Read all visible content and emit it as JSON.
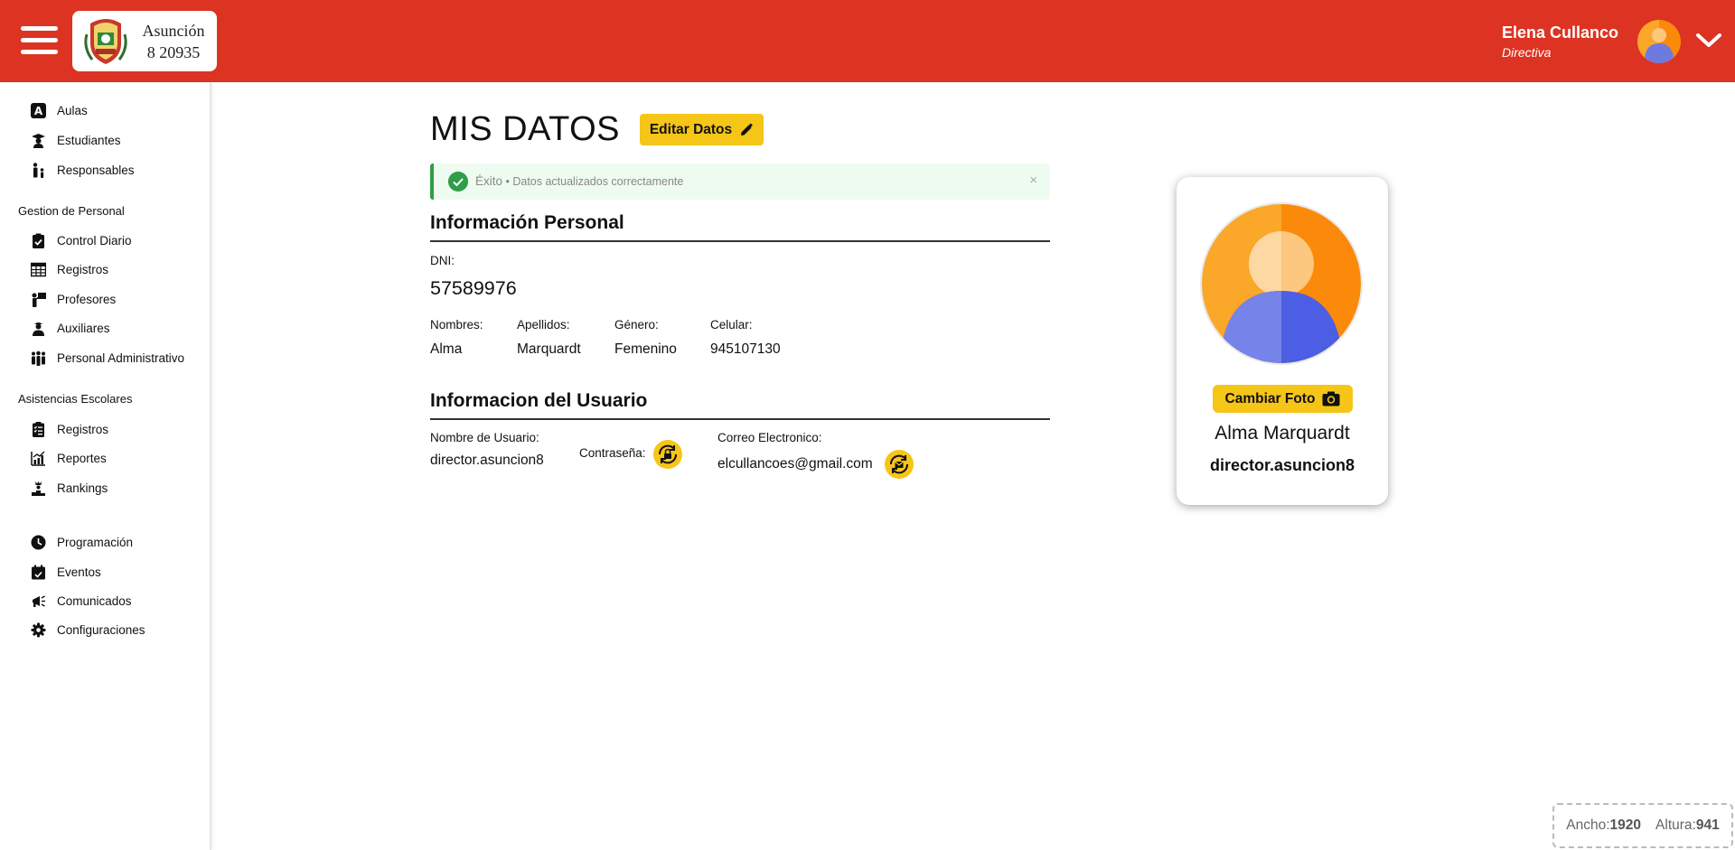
{
  "header": {
    "school_name": "Asunción",
    "school_code": "8 20935",
    "user_name": "Elena Cullanco",
    "user_role": "Directiva",
    "brand_color": "#dd3322"
  },
  "sidebar": {
    "group1": [
      {
        "label": "Aulas",
        "icon": "letter-a-icon"
      },
      {
        "label": "Estudiantes",
        "icon": "graduate-icon"
      },
      {
        "label": "Responsables",
        "icon": "parent-child-icon"
      }
    ],
    "section2_title": "Gestion de Personal",
    "group2": [
      {
        "label": "Control Diario",
        "icon": "clipboard-check-icon"
      },
      {
        "label": "Registros",
        "icon": "table-icon"
      },
      {
        "label": "Profesores",
        "icon": "teacher-icon"
      },
      {
        "label": "Auxiliares",
        "icon": "staff-icon"
      },
      {
        "label": "Personal Administrativo",
        "icon": "group-icon"
      }
    ],
    "section3_title": "Asistencias Escolares",
    "group3": [
      {
        "label": "Registros",
        "icon": "checklist-icon"
      },
      {
        "label": "Reportes",
        "icon": "chart-icon"
      },
      {
        "label": "Rankings",
        "icon": "podium-icon"
      }
    ],
    "group4": [
      {
        "label": "Programación",
        "icon": "clock-icon"
      },
      {
        "label": "Eventos",
        "icon": "calendar-icon"
      },
      {
        "label": "Comunicados",
        "icon": "megaphone-icon"
      },
      {
        "label": "Configuraciones",
        "icon": "gear-icon"
      }
    ]
  },
  "main": {
    "title": "MIS DATOS",
    "edit_label": "Editar Datos",
    "alert": {
      "title": "Éxito",
      "separator": " • ",
      "message": "Datos actualizados correctamente",
      "close": "×"
    },
    "personal_title": "Información Personal",
    "dni_label": "DNI:",
    "dni_value": "57589976",
    "nombres_label": "Nombres:",
    "nombres_value": "Alma",
    "apellidos_label": "Apellidos:",
    "apellidos_value": "Marquardt",
    "genero_label": "Género:",
    "genero_value": "Femenino",
    "celular_label": "Celular:",
    "celular_value": "945107130",
    "user_info_title": "Informacion del Usuario",
    "username_label": "Nombre de Usuario:",
    "username_value": "director.asuncion8",
    "password_label": "Contraseña:",
    "email_label": "Correo Electronico:",
    "email_value": "elcullancoes@gmail.com"
  },
  "profile_card": {
    "change_photo_label": "Cambiar Foto",
    "full_name": "Alma Marquardt",
    "username": "director.asuncion8"
  },
  "viewport": {
    "width_label": "Ancho:",
    "width_value": "1920",
    "height_label": "Altura:",
    "height_value": "941"
  },
  "colors": {
    "accent_yellow": "#f5c518",
    "success_green": "#2e9e48"
  }
}
